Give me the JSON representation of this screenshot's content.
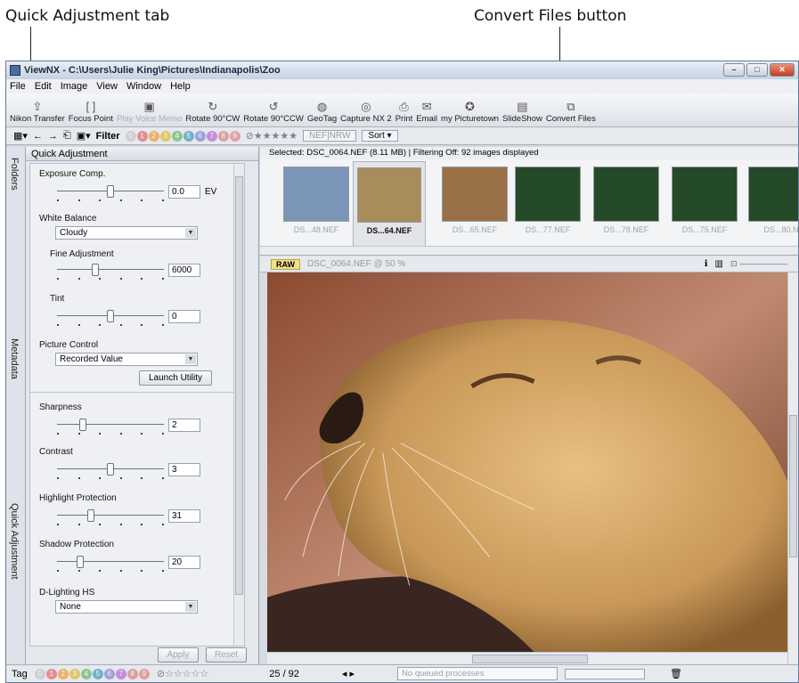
{
  "callouts": {
    "quick_adjustment_tab": "Quick Adjustment tab",
    "convert_files_button": "Convert Files button"
  },
  "window": {
    "title": "ViewNX - C:\\Users\\Julie King\\Pictures\\Indianapolis\\Zoo"
  },
  "menu": [
    "File",
    "Edit",
    "Image",
    "View",
    "Window",
    "Help"
  ],
  "toolbar": [
    {
      "label": "Nikon Transfer",
      "icon": "transfer-icon",
      "glyph": "⇪",
      "enabled": true
    },
    {
      "label": "Focus Point",
      "icon": "focus-point-icon",
      "glyph": "[ ]",
      "enabled": true
    },
    {
      "label": "Play Voice Memo",
      "icon": "voice-memo-icon",
      "glyph": "▣",
      "enabled": false
    },
    {
      "label": "Rotate 90°CW",
      "icon": "rotate-cw-icon",
      "glyph": "↻",
      "enabled": true
    },
    {
      "label": "Rotate 90°CCW",
      "icon": "rotate-ccw-icon",
      "glyph": "↺",
      "enabled": true
    },
    {
      "label": "GeoTag",
      "icon": "geotag-icon",
      "glyph": "◍",
      "enabled": true
    },
    {
      "label": "Capture NX 2",
      "icon": "capture-nx-icon",
      "glyph": "◎",
      "enabled": true
    },
    {
      "label": "Print",
      "icon": "print-icon",
      "glyph": "⎙",
      "enabled": true
    },
    {
      "label": "Email",
      "icon": "email-icon",
      "glyph": "✉",
      "enabled": true
    },
    {
      "label": "my Picturetown",
      "icon": "picturetown-icon",
      "glyph": "✪",
      "enabled": true
    },
    {
      "label": "SlideShow",
      "icon": "slideshow-icon",
      "glyph": "▤",
      "enabled": true
    },
    {
      "label": "Convert Files",
      "icon": "convert-files-icon",
      "glyph": "⧉",
      "enabled": true
    }
  ],
  "toolbar2": {
    "filter_label": "Filter",
    "nef_label": "NEF|NRW",
    "sort_label": "Sort"
  },
  "sidetabs": {
    "folders": "Folders",
    "metadata": "Metadata",
    "quick_adjustment": "Quick Adjustment"
  },
  "panel": {
    "title": "Quick Adjustment",
    "exposure": {
      "label": "Exposure Comp.",
      "value": "0.0",
      "unit": "EV",
      "level": 0.5
    },
    "white_balance": {
      "label": "White Balance",
      "selected": "Cloudy"
    },
    "fine_adjustment": {
      "label": "Fine Adjustment",
      "value": "6000",
      "level": 0.35
    },
    "tint": {
      "label": "Tint",
      "value": "0",
      "level": 0.5
    },
    "picture_control": {
      "label": "Picture Control",
      "selected": "Recorded Value"
    },
    "launch_utility": "Launch Utility",
    "sharpness": {
      "label": "Sharpness",
      "value": "2",
      "level": 0.22
    },
    "contrast": {
      "label": "Contrast",
      "value": "3",
      "level": 0.5
    },
    "highlight": {
      "label": "Highlight Protection",
      "value": "31",
      "level": 0.3
    },
    "shadow": {
      "label": "Shadow Protection",
      "value": "20",
      "level": 0.2
    },
    "dlighting": {
      "label": "D-Lighting HS",
      "selected": "None"
    },
    "apply": "Apply",
    "reset": "Reset"
  },
  "selection_info": "Selected: DSC_0064.NEF (8.11 MB) | Filtering Off: 92 images displayed",
  "thumbnails": [
    {
      "caption": "DS...48.NEF",
      "color": "#7a95b8",
      "selected": false
    },
    {
      "caption": "DS...64.NEF",
      "color": "#a88c5c",
      "selected": true
    },
    {
      "caption": "DS...65.NEF",
      "color": "#9a7048",
      "selected": false
    },
    {
      "caption": "DS...77.NEF",
      "color": "#254a2a",
      "selected": false
    },
    {
      "caption": "DS...78.NEF",
      "color": "#254a2a",
      "selected": false
    },
    {
      "caption": "DS...75.NEF",
      "color": "#254a2a",
      "selected": false
    },
    {
      "caption": "DS...80.N",
      "color": "#254a2a",
      "selected": false
    }
  ],
  "image_bar": {
    "raw": "RAW",
    "file": "DSC_0064.NEF @ 50 %"
  },
  "status": {
    "tag": "Tag",
    "counter": "25 / 92",
    "queue": "No queued processes"
  }
}
